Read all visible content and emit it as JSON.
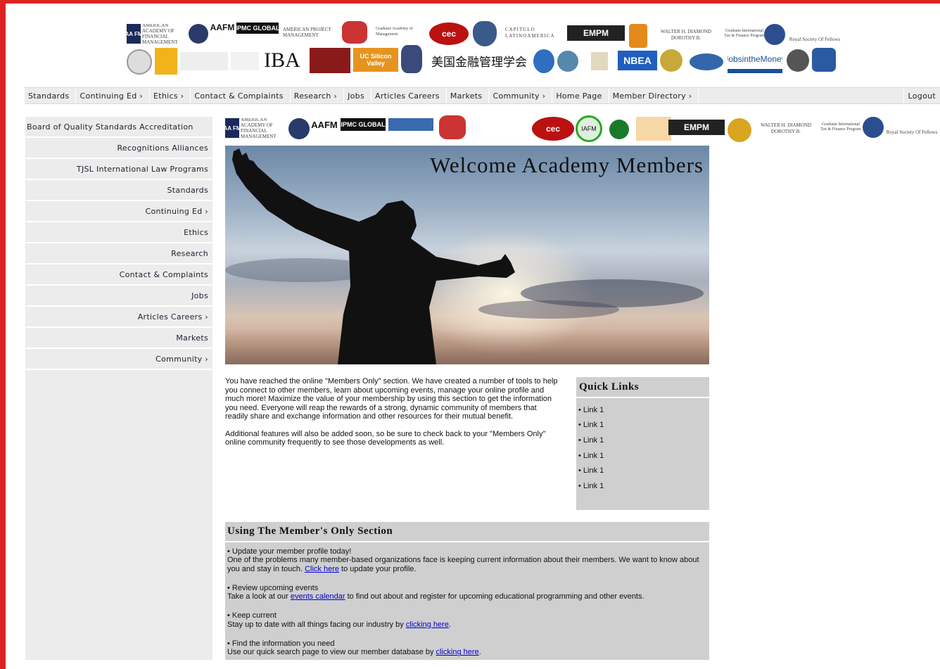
{
  "logos_row1": [
    "AMERICAN ACADEMY OF FINANCIAL MANAGEMENT",
    "AAFM",
    "IPMC GLOBAL",
    "AMERICAN PROJECT MANAGEMENT",
    "Graduate Academy of Management",
    "cec",
    "CAPITULO LATINOAMERICA",
    "EMPM",
    "WALTER H. DIAMOND DOROTHY B.",
    "Graduate International Tax & Finance Program",
    "Royal Society Of Fellows"
  ],
  "logos_row2": [
    "IBA",
    "UC Silicon Valley",
    "美国金融管理学会",
    "NBEA",
    "JobsintheMoney"
  ],
  "logos_strip": [
    "AMERICAN ACADEMY OF FINANCIAL MANAGEMENT",
    "AAFM",
    "IPMC GLOBAL",
    "cec",
    "IAFM",
    "EMPM",
    "WALTER H. DIAMOND DOROTHY B.",
    "Graduate International Tax & Finance Program",
    "Royal Society Of Fellows"
  ],
  "topnav": {
    "items": [
      "Standards",
      "Continuing Ed ›",
      "Ethics ›",
      "Contact & Complaints",
      "Research ›",
      "Jobs",
      "Articles Careers",
      "Markets",
      "Community ›",
      "Home Page",
      "Member Directory ›"
    ],
    "logout": "Logout"
  },
  "sidebar": {
    "items": [
      "Board of Quality Standards Accreditation",
      "Recognitions Alliances",
      "TJSL International Law Programs",
      "Standards",
      "Continuing Ed ›",
      "Ethics",
      "Research",
      "Contact & Complaints",
      "Jobs",
      "Articles Careers ›",
      "Markets",
      "Community ›"
    ]
  },
  "hero": {
    "title": "Welcome Academy Members"
  },
  "intro": {
    "p1": "You have reached the online \"Members Only\" section. We have created a number of tools to help you connect to other members, learn about upcoming events, manage your online profile and much more! Maximize the value of your membership by using this section to get the information you need. Everyone will reap the rewards of a strong, dynamic community of members that readily share and exchange information and other resources for their mutual benefit.",
    "p2": "Additional features will also be added soon, so be sure to check back to your \"Members Only\" online community frequently to see those developments as well."
  },
  "quick_links": {
    "title": "Quick Links",
    "items": [
      "• Link 1",
      "• Link 1",
      "• Link 1",
      "• Link 1",
      "• Link 1",
      "• Link 1"
    ]
  },
  "using": {
    "title": "Using The Member's Only Section",
    "blocks": [
      {
        "head": "• Update your member profile today!",
        "text": "One of the problems many member-based organizations face is keeping current information about their members. We want to know about you and stay in touch. ",
        "link": "Click here",
        "after": " to update your profile."
      },
      {
        "head": "• Review upcoming events",
        "text": "Take a look at our ",
        "link": "events calendar",
        "after": " to find out about and register for upcoming educational programming and other events."
      },
      {
        "head": "• Keep current",
        "text": "Stay up to date with all things facing our industry by ",
        "link": "clicking here",
        "after": "."
      },
      {
        "head": "• Find the information you need",
        "text": "Use our quick search page to view our member database by ",
        "link": "clicking here",
        "after": "."
      }
    ]
  }
}
